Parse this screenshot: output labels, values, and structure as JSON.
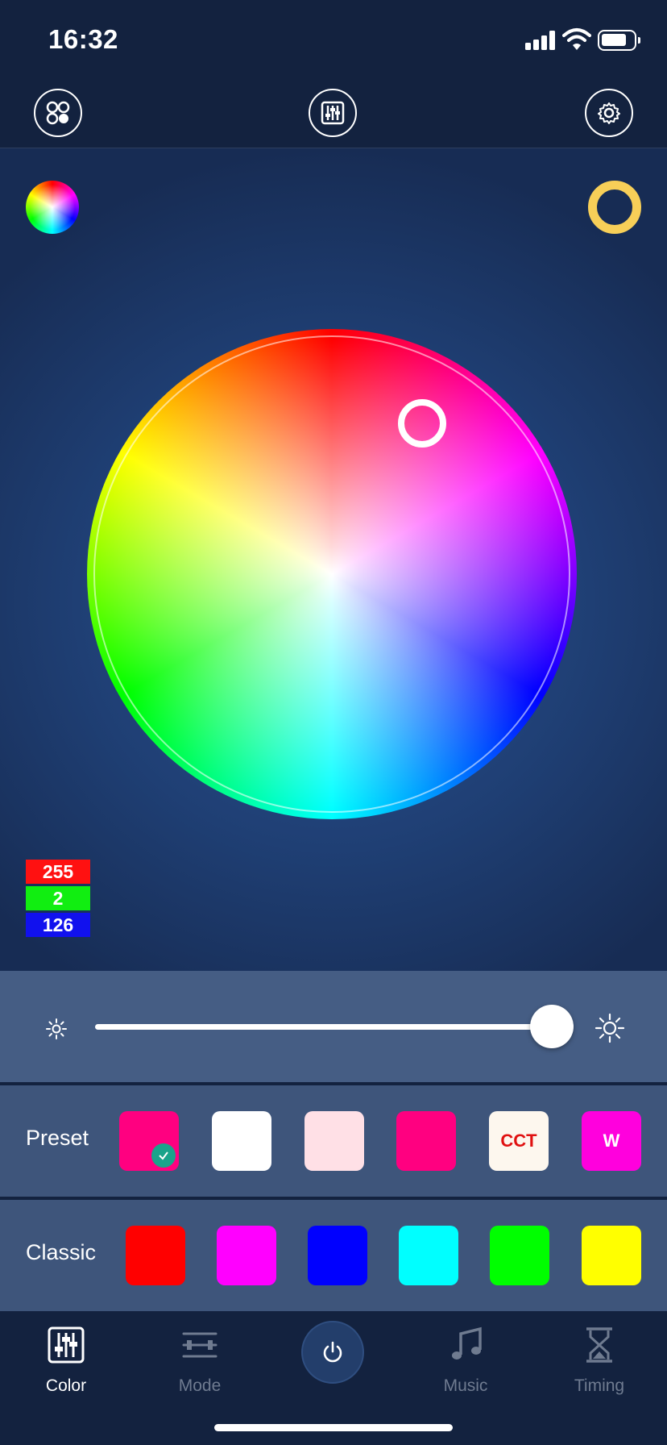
{
  "status": {
    "time": "16:32"
  },
  "rgb": {
    "r": "255",
    "g": "2",
    "b": "126"
  },
  "preset": {
    "label": "Preset",
    "swatches": [
      {
        "color": "#ff0080",
        "text": "",
        "selected": true
      },
      {
        "color": "#ffffff",
        "text": ""
      },
      {
        "color": "#ffe0e6",
        "text": ""
      },
      {
        "color": "#ff0080",
        "text": ""
      },
      {
        "color": "#fdf7ee",
        "text": "CCT",
        "text_color": "#e01111"
      },
      {
        "color": "#ff00dd",
        "text": "W",
        "text_color": "#ffffff"
      }
    ]
  },
  "classic": {
    "label": "Classic",
    "swatches": [
      "#ff0000",
      "#ff00ff",
      "#0000ff",
      "#00ffff",
      "#00ff00",
      "#ffff00"
    ]
  },
  "tabs": [
    {
      "label": "Color",
      "active": true
    },
    {
      "label": "Mode",
      "active": false
    },
    {
      "label": "Music",
      "active": false
    },
    {
      "label": "Timing",
      "active": false
    }
  ],
  "colors": {
    "background": "#13223f",
    "active_tab": "#ffffff",
    "inactive_tab": "#6f7b90",
    "warm_ring": "#f7cf58"
  }
}
